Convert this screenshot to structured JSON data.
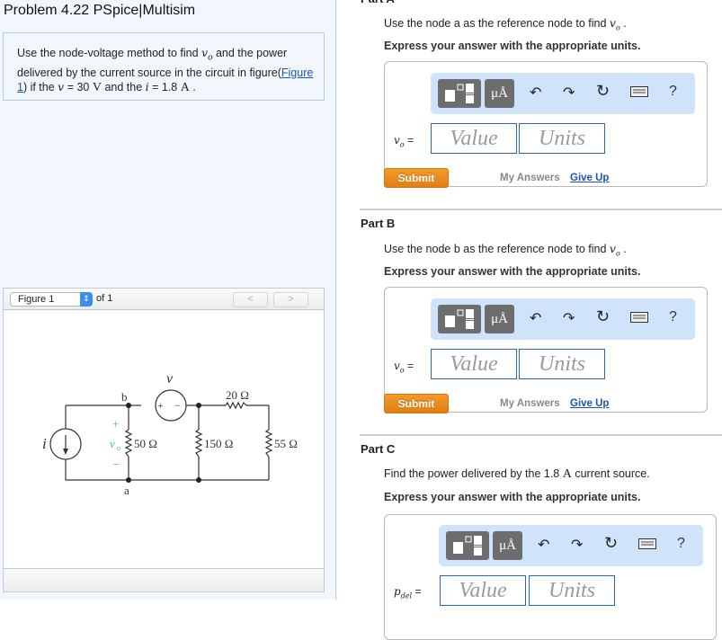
{
  "problem": {
    "title": "Problem 4.22 PSpice|Multisim",
    "statement": {
      "part1": "Use the node-voltage method to find ",
      "var_vo": "v",
      "var_vo_sub": "o",
      "part2": " and the power delivered by the current source in the circuit in figure(",
      "figure_link": "Figure 1",
      "part3": ") if the ",
      "var_v": "v",
      "part4": " = 30 ",
      "unit_v": "V",
      "part5": " and the ",
      "var_i": "i",
      "part6": " = 1.8 ",
      "unit_a": "A",
      "part7": " ."
    }
  },
  "figure": {
    "selected": "Figure 1",
    "of_label": "of 1",
    "prev": "<",
    "next": ">",
    "circuit": {
      "source_v_label": "v",
      "source_i_label": "i",
      "node_b": "b",
      "node_a": "a",
      "vo_label": "v",
      "vo_sub": "o",
      "plus": "+",
      "minus": "−",
      "r1": "50 Ω",
      "r2": "150 Ω",
      "r3": "20 Ω",
      "r4": "55 Ω",
      "src_plus": "+",
      "src_minus": "−"
    }
  },
  "parts": [
    {
      "header": "Part A",
      "question": "Use the node a as the reference node to find ",
      "question_var": "v",
      "question_sub": "o",
      "question_end": " .",
      "instruction": "Express your answer with the appropriate units.",
      "answer_label_var": "v",
      "answer_label_sub": "o",
      "equals": "=",
      "value_placeholder": "Value",
      "units_placeholder": "Units",
      "submit": "Submit",
      "my_answers": "My Answers",
      "give_up": "Give Up"
    },
    {
      "header": "Part B",
      "question": "Use the node b as the reference node to find ",
      "question_var": "v",
      "question_sub": "o",
      "question_end": " .",
      "instruction": "Express your answer with the appropriate units.",
      "answer_label_var": "v",
      "answer_label_sub": "o",
      "equals": "=",
      "value_placeholder": "Value",
      "units_placeholder": "Units",
      "submit": "Submit",
      "my_answers": "My Answers",
      "give_up": "Give Up"
    },
    {
      "header": "Part C",
      "question": "Find the power delivered by the 1.8 ",
      "question_unit": "A",
      "question_end": " current source.",
      "instruction": "Express your answer with the appropriate units.",
      "answer_label_var": "p",
      "answer_label_sub": "del",
      "equals": "=",
      "value_placeholder": "Value",
      "units_placeholder": "Units"
    }
  ],
  "toolbar": {
    "templates_icon": "templates-icon",
    "units_label": "μÅ",
    "undo_icon": "↶",
    "redo_icon": "↷",
    "reset_icon": "↻",
    "keyboard_icon": "keyboard-icon",
    "help_label": "?"
  }
}
